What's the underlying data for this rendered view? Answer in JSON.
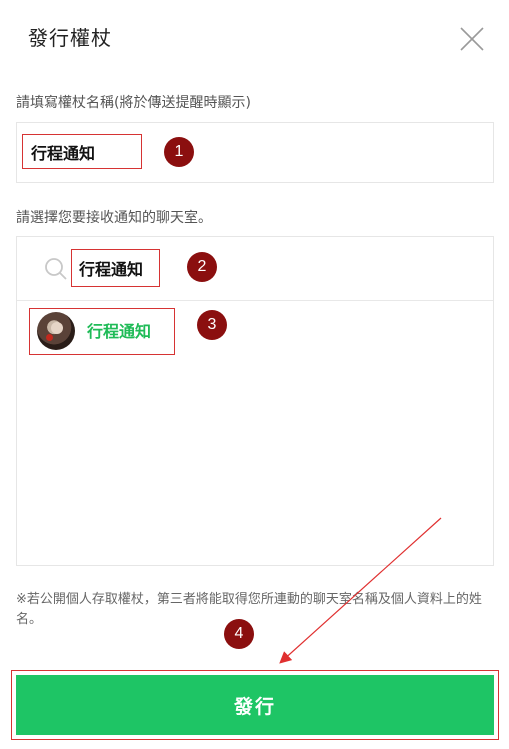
{
  "header": {
    "title": "發行權杖"
  },
  "token_name": {
    "label": "請填寫權杖名稱(將於傳送提醒時顯示)",
    "value": "行程通知"
  },
  "chat_select": {
    "label": "請選擇您要接收通知的聊天室。",
    "search_value": "行程通知",
    "items": [
      {
        "name": "行程通知"
      }
    ]
  },
  "note": "※若公開個人存取權杖，第三者將能取得您所連動的聊天室名稱及個人資料上的姓名。",
  "issue_button": {
    "label": "發行"
  },
  "markers": [
    "1",
    "2",
    "3",
    "4"
  ],
  "colors": {
    "accent": "#1ec565",
    "highlight": "#d63333",
    "marker": "#8b0f0f",
    "chat_name": "#1fbb57"
  }
}
